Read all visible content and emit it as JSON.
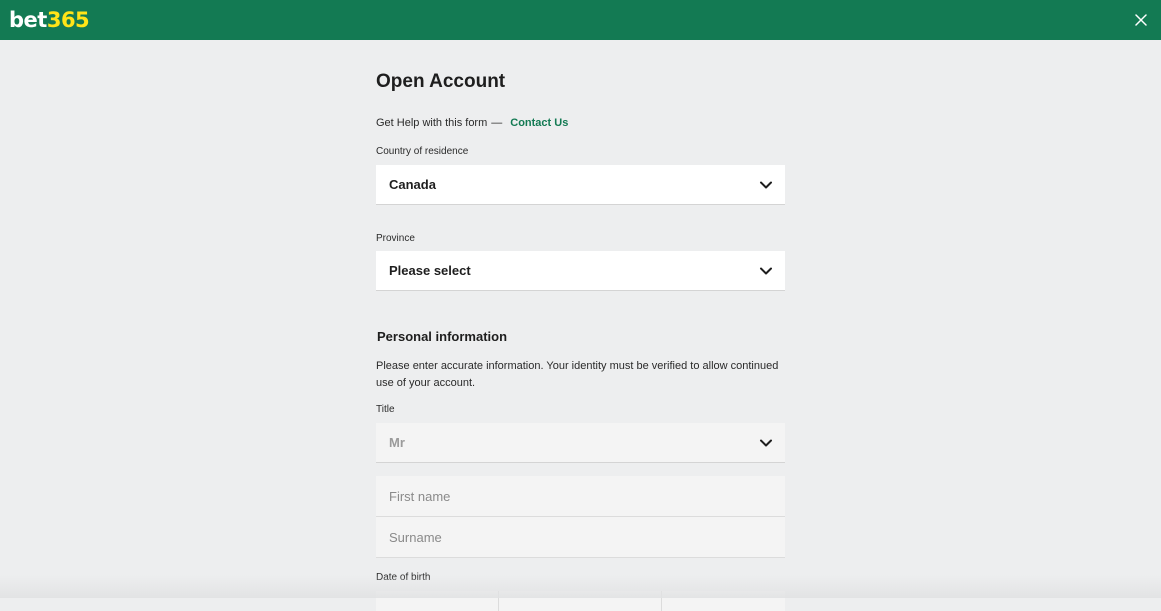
{
  "header": {
    "logo_part1": "bet",
    "logo_part2": "365",
    "brand_color": "#137a53",
    "logo_accent": "#ffe418",
    "close_icon": "close-icon"
  },
  "form": {
    "title": "Open Account",
    "help": {
      "text": "Get Help with this form",
      "dash": "—",
      "contact_label": "Contact Us"
    },
    "country": {
      "label": "Country of residence",
      "value": "Canada"
    },
    "province": {
      "label": "Province",
      "value": "Please select"
    },
    "personal": {
      "title": "Personal information",
      "info": "Please enter accurate information. Your identity must be verified to allow continued use of your account."
    },
    "title_field": {
      "label": "Title",
      "value": "Mr"
    },
    "first_name": {
      "placeholder": "First name"
    },
    "surname": {
      "placeholder": "Surname"
    },
    "dob": {
      "label": "Date of birth"
    }
  }
}
